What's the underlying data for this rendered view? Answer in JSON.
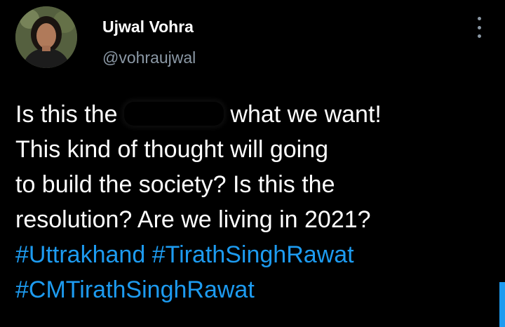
{
  "user": {
    "display_name": "Ujwal Vohra",
    "handle": "@vohraujwal"
  },
  "tweet": {
    "line1_before_redaction": "Is this the ",
    "line1_after_redaction": " what we want!",
    "line2": "This kind of thought will going",
    "line3": "to build the society? Is this the",
    "line4": "resolution? Are we living in 2021?",
    "hashtags": [
      "#Uttrakhand",
      "#TirathSinghRawat",
      "#CMTirathSinghRawat"
    ]
  },
  "colors": {
    "background": "#000000",
    "text": "#ffffff",
    "secondary_text": "#8b98a5",
    "link": "#1d9bf0"
  },
  "icons": {
    "more": "vertical-ellipsis"
  }
}
